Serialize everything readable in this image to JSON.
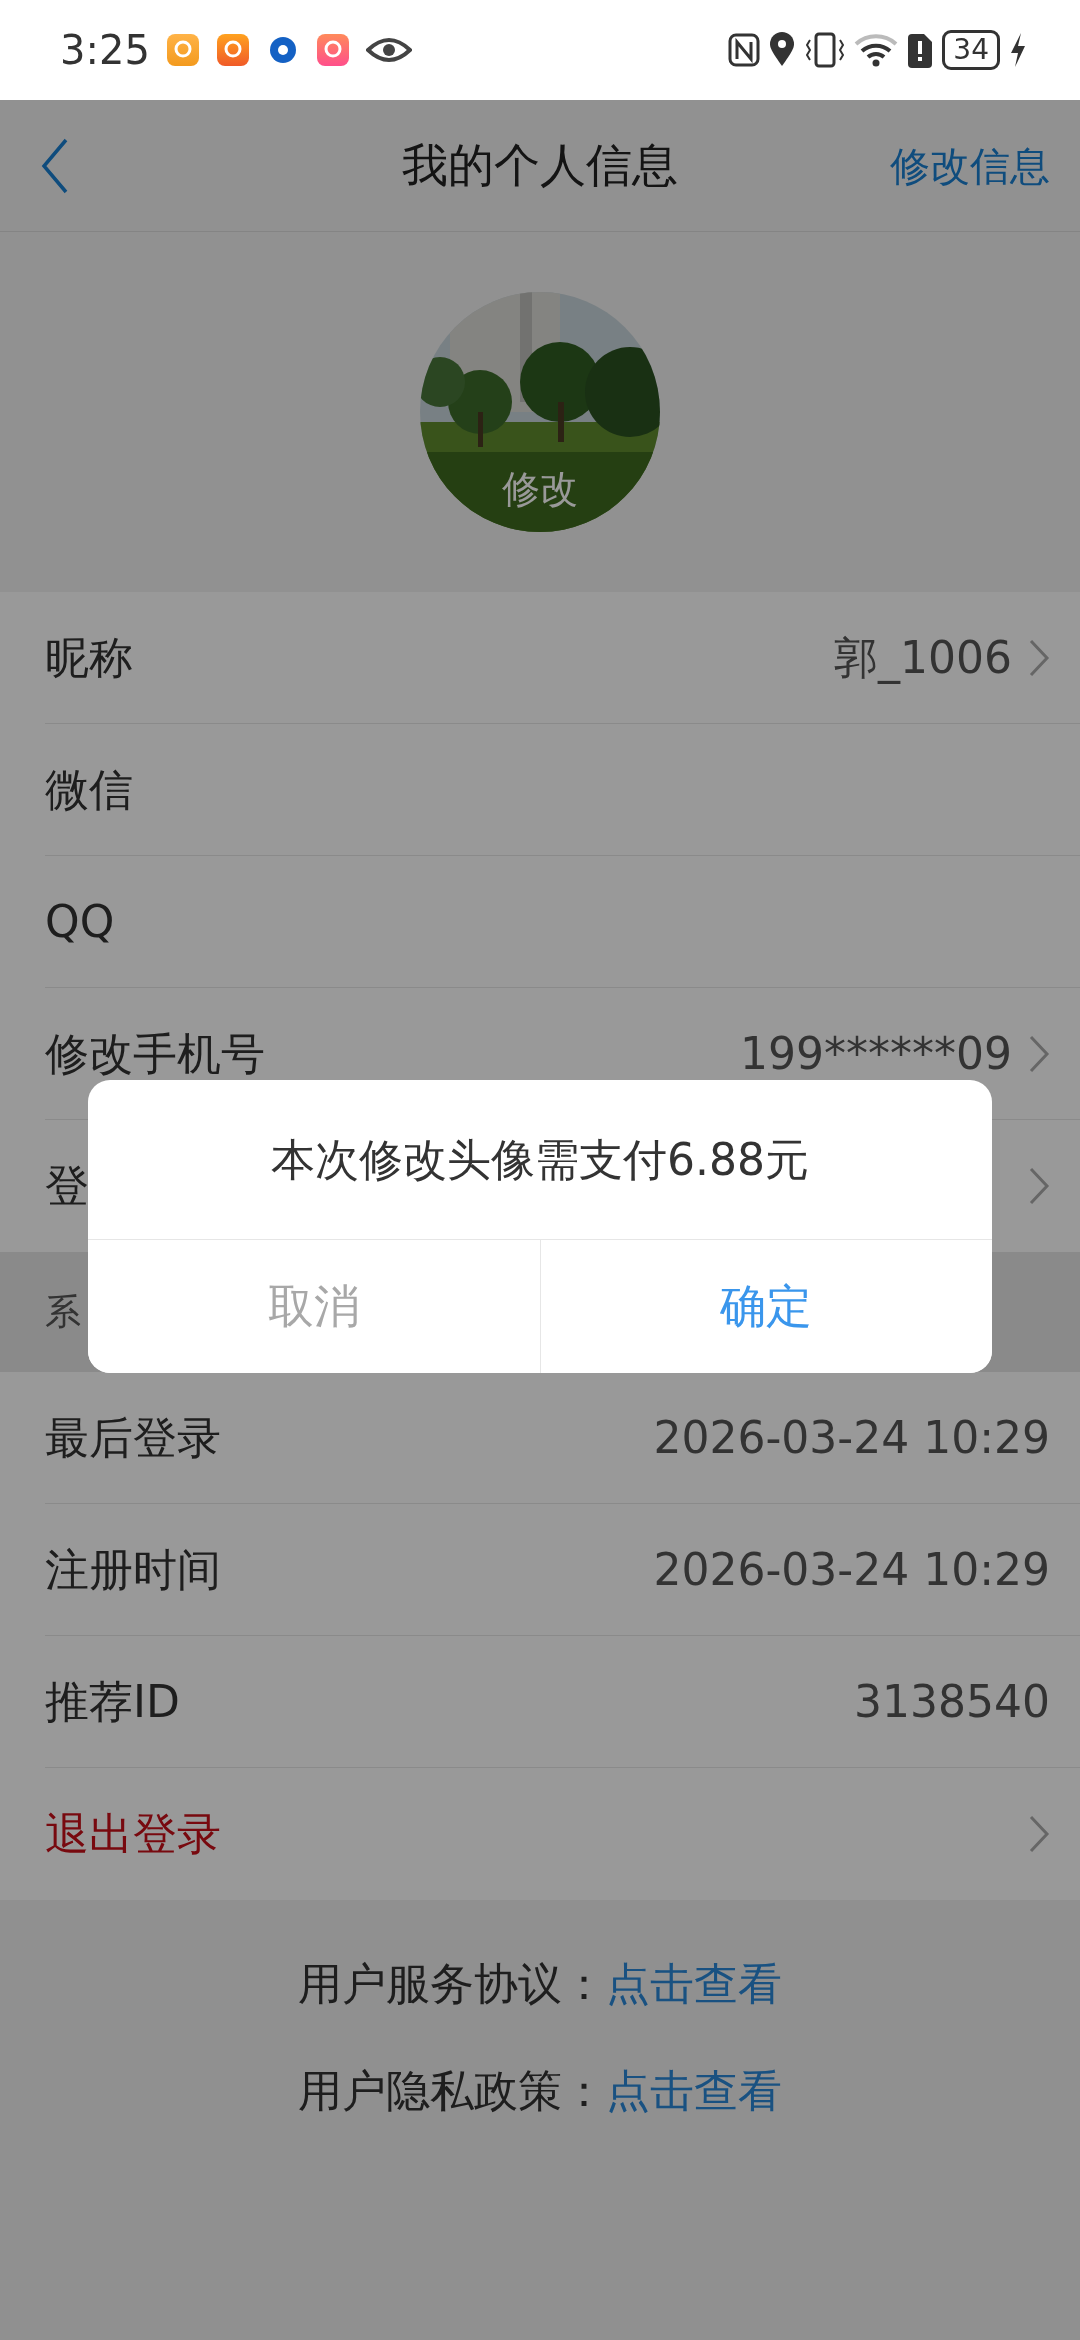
{
  "status_bar": {
    "time": "3:25",
    "battery": "34"
  },
  "header": {
    "title": "我的个人信息",
    "action": "修改信息"
  },
  "avatar": {
    "kind": "picture",
    "caption": "修改"
  },
  "profile_rows": [
    {
      "label": "昵称",
      "value": "郭_1006",
      "chevron": true
    },
    {
      "label": "微信",
      "chevron": false
    },
    {
      "label": "QQ",
      "chevron": false
    },
    {
      "label": "修改手机号",
      "value": "199******09",
      "chevron": true
    },
    {
      "label": "登",
      "chevron": true
    }
  ],
  "section_header": "系",
  "system_rows": [
    {
      "label": "最后登录",
      "value": "2026-03-24 10:29",
      "kind": "normal",
      "chevron": false
    },
    {
      "label": "注册时间",
      "value": "2026-03-24 10:29",
      "kind": "normal",
      "chevron": false
    },
    {
      "label": "推荐ID",
      "value": "3138540",
      "kind": "normal",
      "chevron": false
    },
    {
      "label": "退出登录",
      "kind": "danger",
      "chevron": true
    }
  ],
  "links": [
    {
      "label": "用户服务协议：",
      "link": "点击查看"
    },
    {
      "label": "用户隐私政策：",
      "link": "点击查看"
    }
  ],
  "dialog": {
    "message": "本次修改头像需支付6.88元",
    "buttons": [
      {
        "label": "取消",
        "kind": "cancel"
      },
      {
        "label": "确定",
        "kind": "confirm"
      }
    ]
  }
}
